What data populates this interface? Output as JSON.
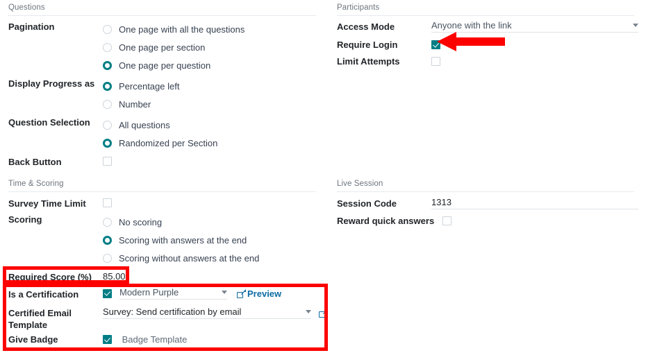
{
  "left_column": {
    "groups": [
      {
        "title": "Questions",
        "fields": [
          {
            "label": "Pagination",
            "type": "radio",
            "options": [
              {
                "label": "One page with all the questions",
                "checked": false
              },
              {
                "label": "One page per section",
                "checked": false
              },
              {
                "label": "One page per question",
                "checked": true
              }
            ]
          },
          {
            "label": "Display Progress as",
            "type": "radio",
            "options": [
              {
                "label": "Percentage left",
                "checked": true
              },
              {
                "label": "Number",
                "checked": false
              }
            ]
          },
          {
            "label": "Question Selection",
            "type": "radio",
            "options": [
              {
                "label": "All questions",
                "checked": false
              },
              {
                "label": "Randomized per Section",
                "checked": true
              }
            ]
          },
          {
            "label": "Back Button",
            "type": "checkbox",
            "checked": false
          }
        ]
      },
      {
        "title": "Time & Scoring",
        "fields": [
          {
            "label": "Survey Time Limit",
            "type": "checkbox",
            "checked": false
          },
          {
            "label": "Scoring",
            "type": "radio",
            "options": [
              {
                "label": "No scoring",
                "checked": false
              },
              {
                "label": "Scoring with answers at the end",
                "checked": true
              },
              {
                "label": "Scoring without answers at the end",
                "checked": false
              }
            ]
          },
          {
            "label": "Required Score (%)",
            "type": "text",
            "value": "85.00"
          },
          {
            "label": "Is a Certification",
            "type": "checkbox_select_link",
            "checked": true,
            "select_value": "Modern Purple",
            "link_label": "Preview"
          },
          {
            "label": "Certified Email Template",
            "label_line1": "Certified Email",
            "label_line2": "Template",
            "type": "select_with_external",
            "select_value": "Survey: Send certification by email"
          },
          {
            "label": "Give Badge",
            "type": "checkbox_link",
            "checked": true,
            "link_label": "Badge Template"
          }
        ]
      }
    ]
  },
  "right_column": {
    "groups": [
      {
        "title": "Participants",
        "fields": [
          {
            "label": "Access Mode",
            "type": "select",
            "value": "Anyone with the link"
          },
          {
            "label": "Require Login",
            "type": "checkbox",
            "checked": true
          },
          {
            "label": "Limit Attempts",
            "type": "checkbox",
            "checked": false
          }
        ]
      },
      {
        "title": "Live Session",
        "fields": [
          {
            "label": "Session Code",
            "type": "input",
            "value": "1313"
          },
          {
            "label": "Reward quick answers",
            "type": "checkbox",
            "checked": false
          }
        ]
      }
    ]
  },
  "annotations": {
    "color": "#fd0100",
    "highlight_required_score": "Required Score (%) 85.00",
    "highlight_certification_block": "Certification settings block",
    "arrow_points_to": "Require Login checkbox"
  },
  "theme": {
    "accent": "#017e84",
    "link": "#0b6aa2",
    "label": "#212529",
    "muted": "#6c757d",
    "annotation_red": "#fd0100"
  }
}
